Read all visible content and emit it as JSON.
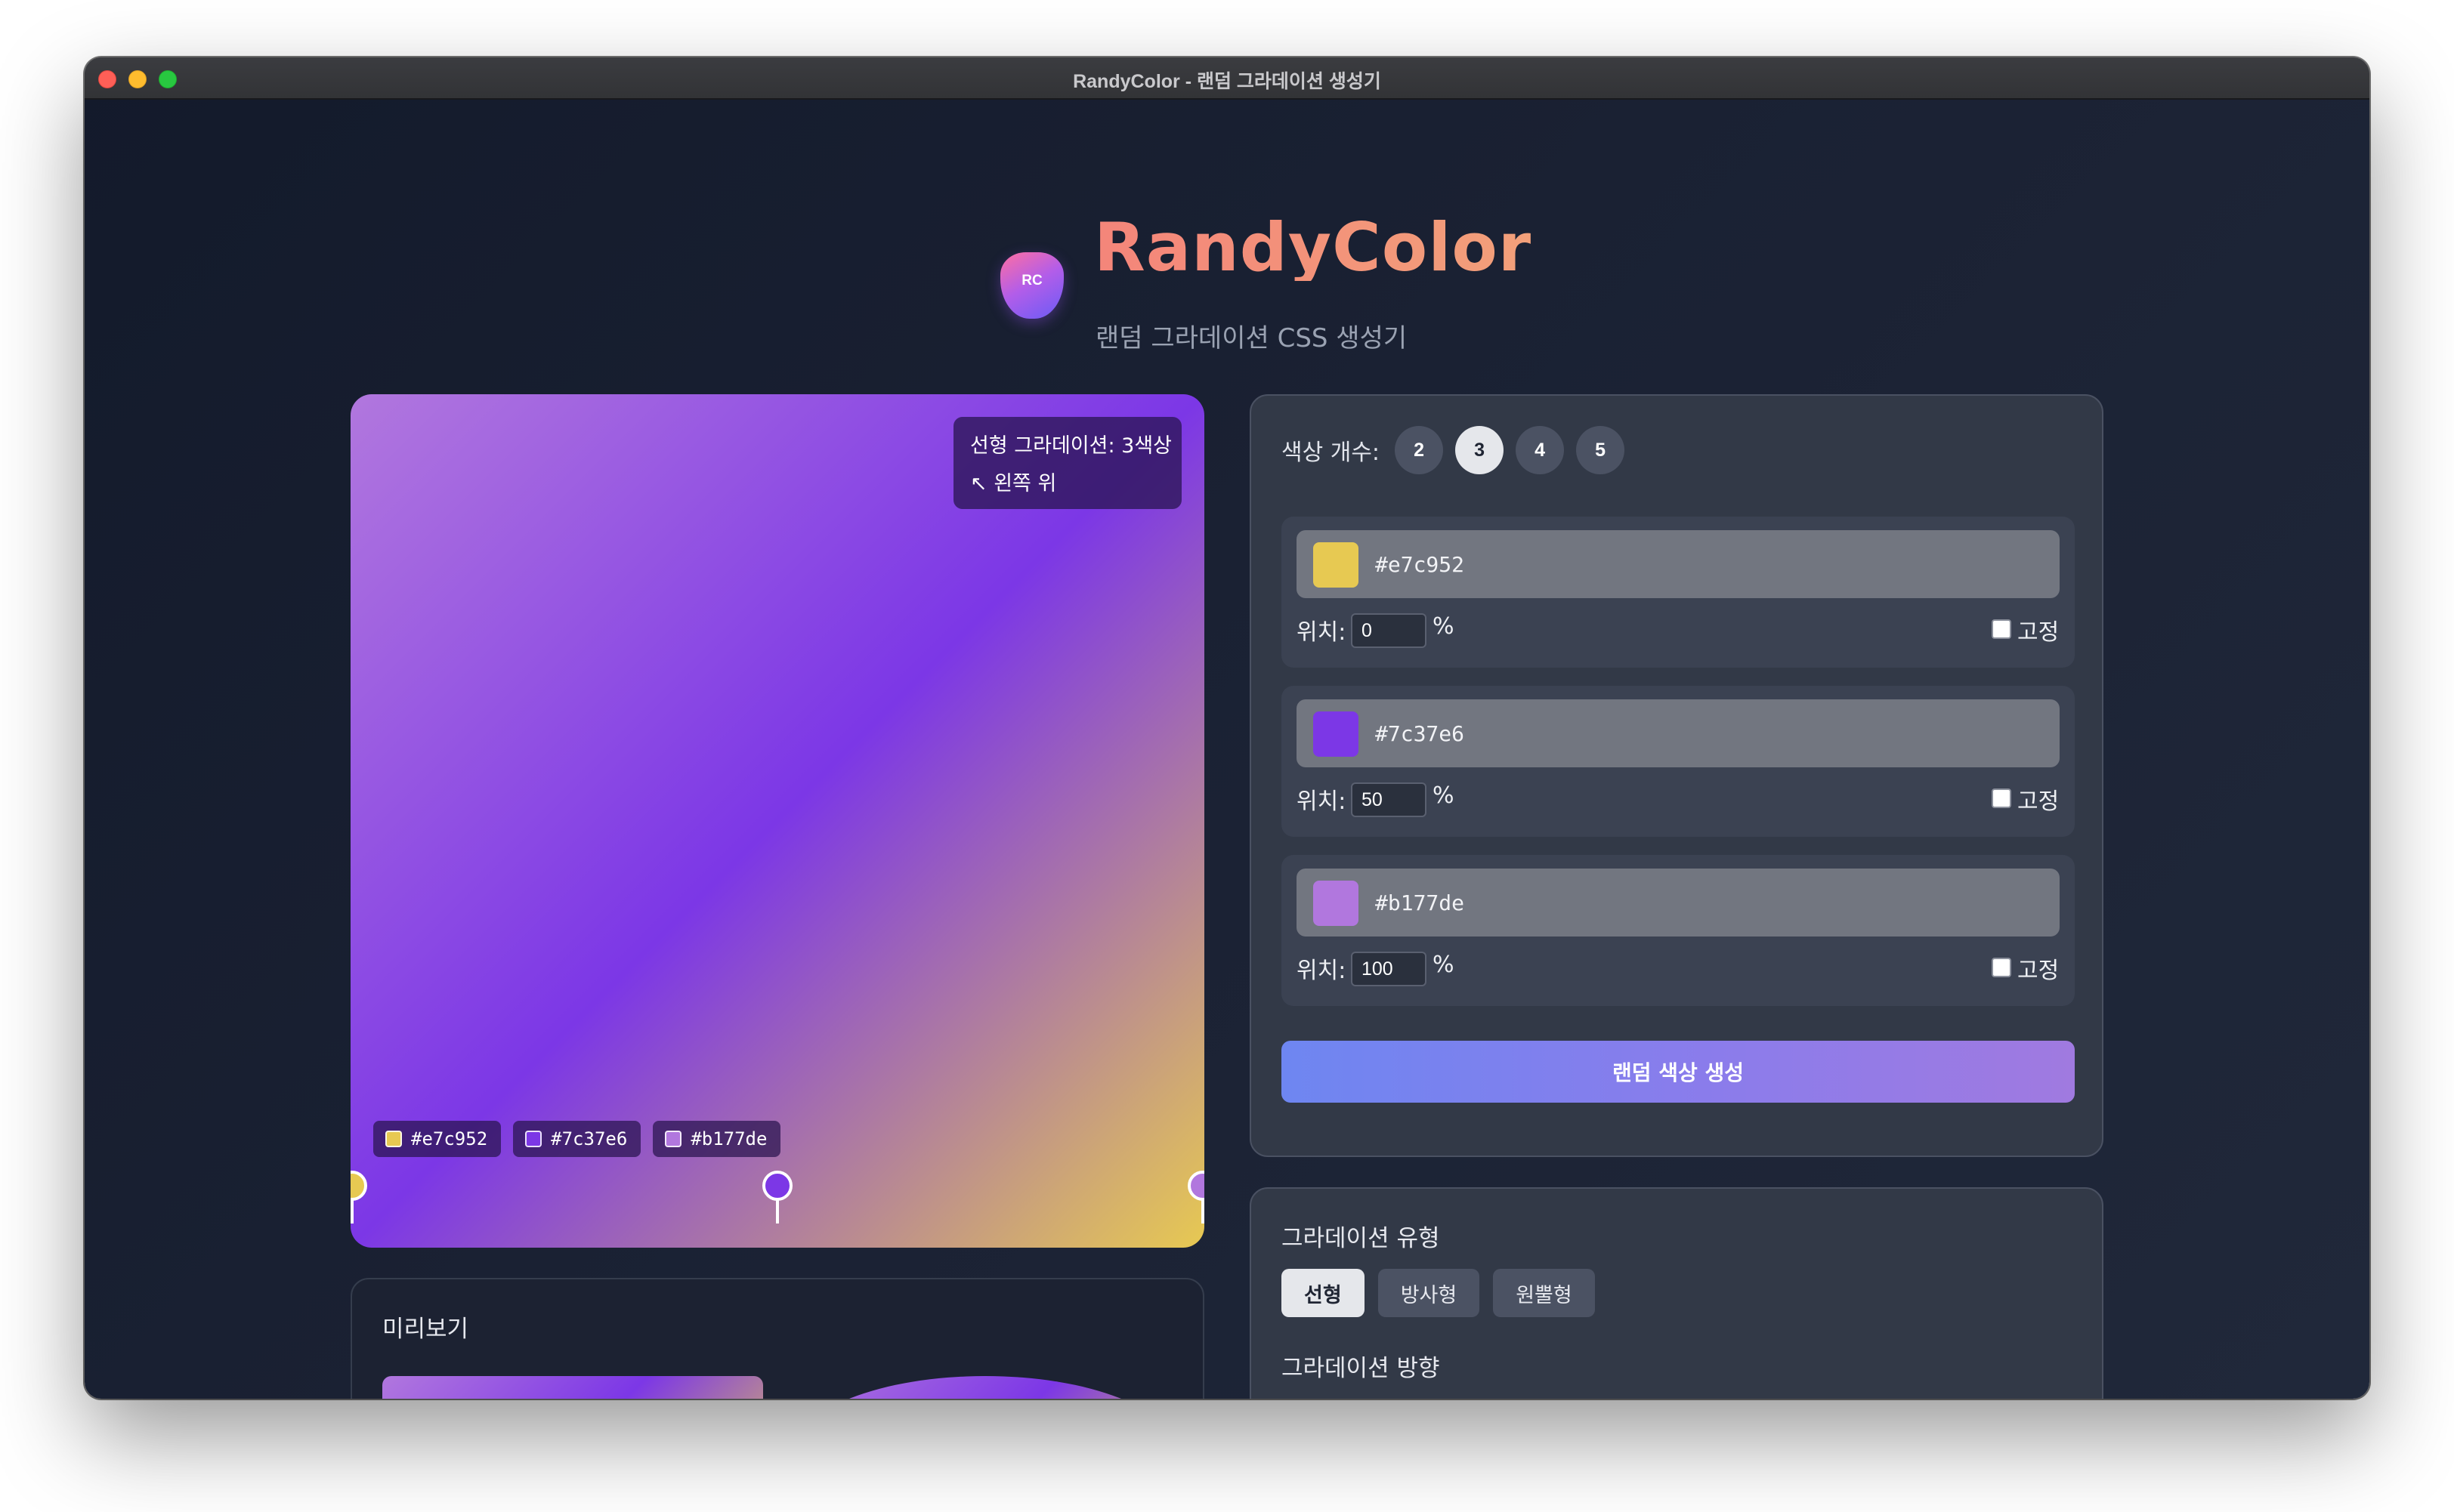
{
  "window": {
    "title": "RandyColor - 랜덤 그라데이션 생성기"
  },
  "header": {
    "logo_text": "RC",
    "app_name": "RandyColor",
    "subtitle": "랜덤 그라데이션 CSS 생성기"
  },
  "preview": {
    "info_line1": "선형 그라데이션: 3색상",
    "info_line2": "↖ 왼쪽 위",
    "gradient_type": "linear",
    "direction_deg": 135,
    "chips": [
      {
        "hex": "#e7c952"
      },
      {
        "hex": "#7c37e6"
      },
      {
        "hex": "#b177de"
      }
    ],
    "stop_markers": [
      {
        "color": "#e7c952",
        "position_pct": 0
      },
      {
        "color": "#7c37e6",
        "position_pct": 50
      },
      {
        "color": "#b177de",
        "position_pct": 100
      }
    ]
  },
  "mini_preview": {
    "title": "미리보기"
  },
  "controls": {
    "count_label": "색상 개수:",
    "count_options": [
      "2",
      "3",
      "4",
      "5"
    ],
    "count_selected": "3",
    "position_label": "위치:",
    "percent_unit": "%",
    "lock_label": "고정",
    "color_stops": [
      {
        "hex": "#e7c952",
        "position": "0",
        "locked": false
      },
      {
        "hex": "#7c37e6",
        "position": "50",
        "locked": false
      },
      {
        "hex": "#b177de",
        "position": "100",
        "locked": false
      }
    ],
    "random_button": "랜덤 색상 생성"
  },
  "gradient_type": {
    "title": "그라데이션 유형",
    "options": [
      "선형",
      "방사형",
      "원뿔형"
    ],
    "selected": "선형"
  },
  "gradient_direction": {
    "title": "그라데이션 방향"
  },
  "colors": {
    "accent_start": "#6e86f1",
    "accent_end": "#a07ae0",
    "brand_title": "#f4857a"
  }
}
